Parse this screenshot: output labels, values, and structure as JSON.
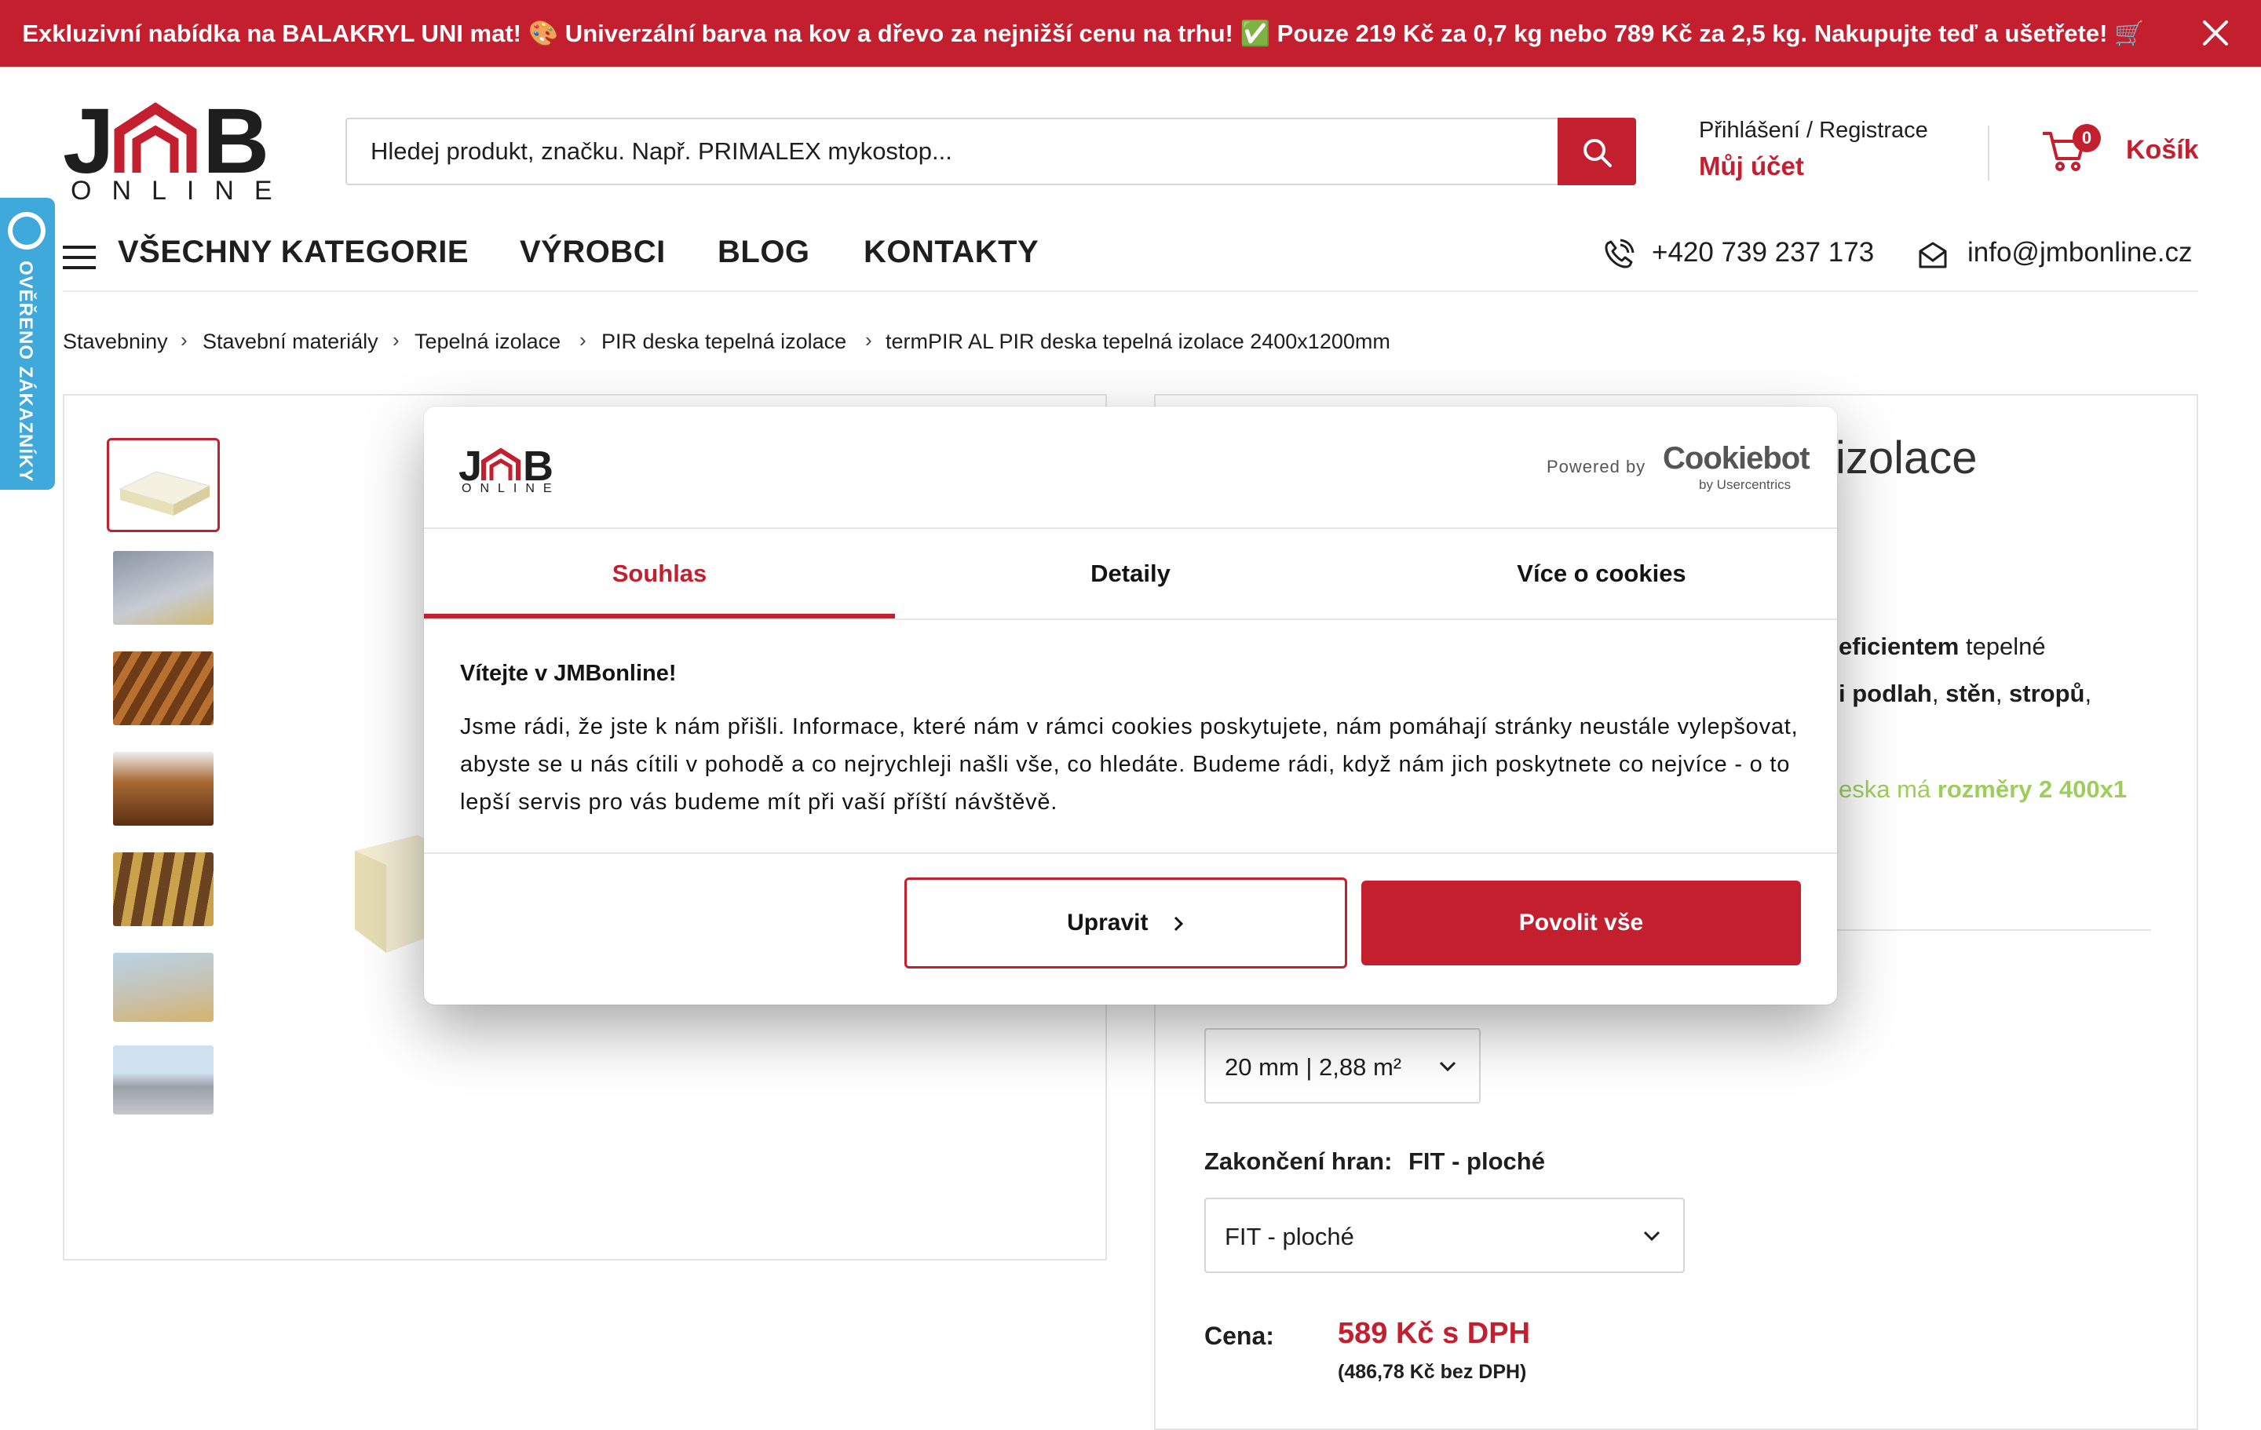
{
  "announcement": {
    "text": "Exkluzivní nabídka na BALAKRYL UNI mat! 🎨 Univerzální barva na kov a dřevo za nejnižší cenu na trhu! ✅ Pouze 219 Kč za 0,7 kg nebo 789 Kč za 2,5 kg. Nakupujte teď a ušetřete! 🛒"
  },
  "logo": {
    "top": "JMB",
    "bottom": "ONLINE"
  },
  "search": {
    "placeholder": "Hledej produkt, značku. Např. PRIMALEX mykostop..."
  },
  "account": {
    "login": "Přihlášení / Registrace",
    "my_account": "Můj účet"
  },
  "cart": {
    "count": "0",
    "label": "Košík"
  },
  "nav": {
    "items": [
      "VŠECHNY KATEGORIE",
      "VÝROBCI",
      "BLOG",
      "KONTAKTY"
    ],
    "phone": "+420 739 237 173",
    "email": "info@jmbonline.cz"
  },
  "side_badge": {
    "label": "OVĚŘENO ZÁKAZNÍKY"
  },
  "breadcrumb": [
    "Stavebniny",
    "Stavební materiály",
    "Tepelná izolace",
    "PIR deska tepelná izolace",
    "termPIR AL PIR deska tepelná izolace 2400x1200mm"
  ],
  "product": {
    "title_fragment": "izolace",
    "desc_line1_bold": "eficientem",
    "desc_line1_rest": " tepelné",
    "desc_line2_a": "i podlah",
    "desc_line2_b": ", ",
    "desc_line2_c": "stěn",
    "desc_line2_d": ", ",
    "desc_line2_e": "stropů",
    "desc_line2_f": ",",
    "desc_line3_a": "eska má ",
    "desc_line3_b": "rozměry 2 400x1",
    "variant_value": "20 mm | 2,88 m²",
    "edge_label": "Zakončení hran:",
    "edge_value": "FIT - ploché",
    "edge_select": "FIT - ploché",
    "price_label": "Cena:",
    "price": "589 Kč s DPH",
    "price_net": "(486,78 Kč bez DPH)"
  },
  "cookie": {
    "powered_by": "Powered by",
    "brand": "Cookiebot",
    "brand_sub": "by Usercentrics",
    "tabs": [
      "Souhlas",
      "Detaily",
      "Více o cookies"
    ],
    "heading": "Vítejte v JMBonline!",
    "body": "Jsme rádi, že jste k nám přišli. Informace, které nám v rámci cookies poskytujete, nám pomáhají stránky neustále vylepšovat, abyste se u nás cítili v pohodě a co nejrychleji našli vše, co hledáte. Budeme rádi, když nám jich poskytnete co nejvíce - o to lepší servis pro vás budeme mít při vaší příští návštěvě.",
    "customize": "Upravit",
    "allow_all": "Povolit vše"
  },
  "colors": {
    "brand_red": "#c41f2f",
    "green": "#8cc63f",
    "text": "#1e1e1e",
    "badge_blue": "#3fa9dc"
  }
}
